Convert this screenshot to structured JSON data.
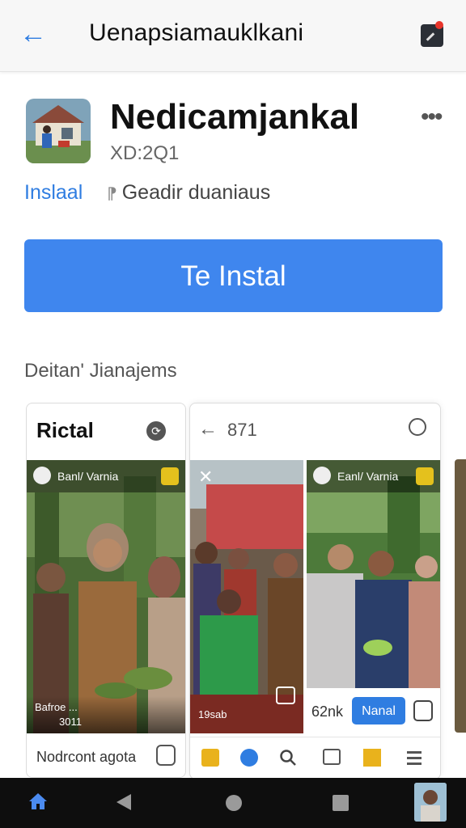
{
  "topbar": {
    "back_label": "←",
    "title": "Uenapsiamauklkani"
  },
  "app": {
    "name": "Nedicamjankal",
    "version": "XD:2Q1",
    "more_label": "•••",
    "install_link": "Inslaal",
    "developer": "Geadir duaniaus",
    "install_button": "Te Instal"
  },
  "section": {
    "title": "Deitan' Jianajems"
  },
  "card_left": {
    "title": "Rictal",
    "photo_header_name": "Banl/ Varnia",
    "photo_footer_text": "Bafroe ...",
    "photo_count": "3011",
    "footer_text": "Nodrcont agota"
  },
  "card_right": {
    "back_label": "←",
    "number": "871",
    "photo1_close": "✕",
    "photo2_header_name": "Eanl/ Varnia",
    "photo1_footer": "19sab",
    "badge_text": "62nk",
    "button_label": "Nanal"
  },
  "nav": {
    "home_icon": "home-icon",
    "back_icon": "back-triangle-icon",
    "recent_icon": "recent-apps-icon"
  },
  "colors": {
    "accent": "#3f86ee",
    "link": "#2f7de1",
    "navbar": "#0e0e0e",
    "badge": "#e8352b"
  }
}
